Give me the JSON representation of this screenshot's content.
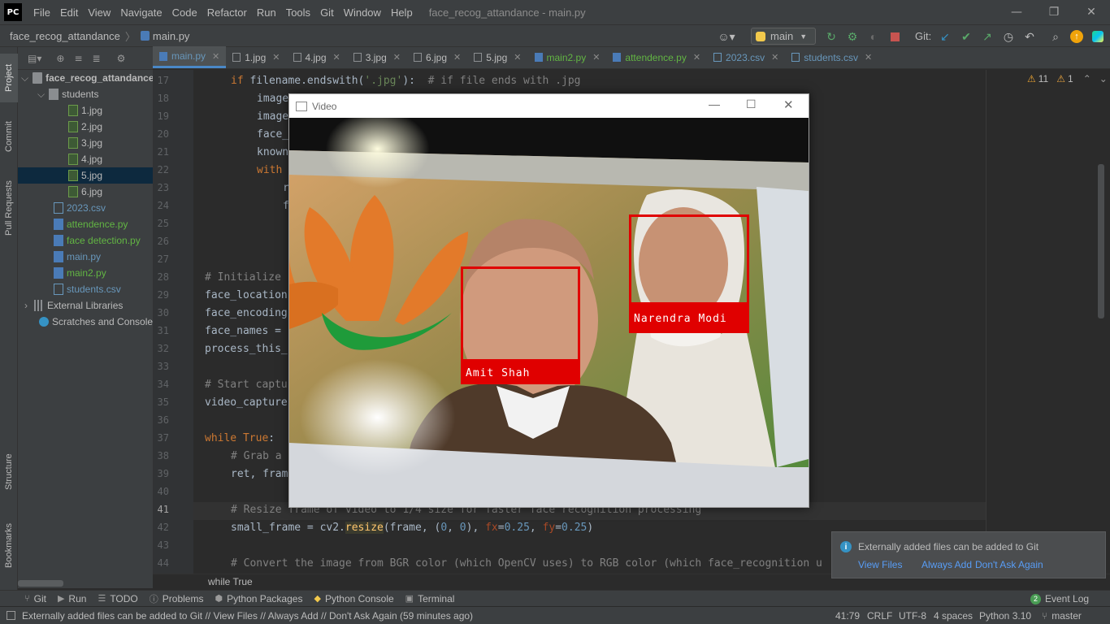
{
  "app": {
    "logo": "PC",
    "window_title": "face_recog_attandance - main.py",
    "menu": [
      "File",
      "Edit",
      "View",
      "Navigate",
      "Code",
      "Refactor",
      "Run",
      "Tools",
      "Git",
      "Window",
      "Help"
    ]
  },
  "navbar": {
    "project": "face_recog_attandance",
    "file": "main.py",
    "run_config": "main",
    "git_label": "Git:"
  },
  "left_stripe": {
    "project": "Project",
    "commit": "Commit",
    "pull_requests": "Pull Requests",
    "structure": "Structure",
    "bookmarks": "Bookmarks"
  },
  "project_tree": {
    "root": "face_recog_attandance",
    "students_folder": "students",
    "students_files": [
      "1.jpg",
      "2.jpg",
      "3.jpg",
      "4.jpg",
      "5.jpg",
      "6.jpg"
    ],
    "root_files": [
      "2023.csv",
      "attendence.py",
      "face detection.py",
      "main.py",
      "main2.py",
      "students.csv"
    ],
    "external": "External Libraries",
    "scratches": "Scratches and Consoles"
  },
  "tabs": [
    "main.py",
    "1.jpg",
    "4.jpg",
    "3.jpg",
    "6.jpg",
    "5.jpg",
    "main2.py",
    "attendence.py",
    "2023.csv",
    "students.csv"
  ],
  "editor": {
    "line_numbers": [
      "17",
      "18",
      "19",
      "20",
      "21",
      "22",
      "23",
      "24",
      "25",
      "26",
      "27",
      "28",
      "29",
      "30",
      "31",
      "32",
      "33",
      "34",
      "35",
      "36",
      "37",
      "38",
      "39",
      "40",
      "41",
      "42",
      "43",
      "44"
    ],
    "warnings": "11",
    "weak_warnings": "1",
    "breadcrumb": "while True"
  },
  "code": {
    "l17_kw": "if",
    "l17_a": " filename.endswith(",
    "l17_str": "'.jpg'",
    "l17_b": "):  ",
    "l17_cm": "# if file ends with .jpg",
    "l18": "image",
    "l19": "image",
    "l20": "face_",
    "l21": "known",
    "l22": "with",
    "l23": "r",
    "l24": "f",
    "l28": "# Initialize",
    "l29": "face_location",
    "l30": "face_encoding",
    "l31": "face_names =",
    "l32": "process_this_",
    "l34": "# Start captu",
    "l35": "video_capture",
    "l37_kw": "while",
    "l37_b": " True",
    "l37_c": ":",
    "l38": "# Grab a",
    "l39": "ret, fram",
    "l41": "# Resize frame of video to 1/4 size for faster face recognition processing",
    "l42_a": "small_frame = cv2.",
    "l42_fn": "resize",
    "l42_b": "(frame, (",
    "l42_n1": "0",
    "l42_c": ", ",
    "l42_n2": "0",
    "l42_d": "), ",
    "l42_p1": "fx",
    "l42_e": "=",
    "l42_n3": "0.25",
    "l42_f": ", ",
    "l42_p2": "fy",
    "l42_g": "=",
    "l42_n4": "0.25",
    "l42_h": ")",
    "l44": "# Convert the image from BGR color (which OpenCV uses) to RGB color (which face_recognition u"
  },
  "video_window": {
    "title": "Video",
    "faces": [
      {
        "name": "Amit Shah"
      },
      {
        "name": "Narendra Modi"
      }
    ]
  },
  "notification": {
    "message": "Externally added files can be added to Git",
    "actions": [
      "View Files",
      "Always Add",
      "Don't Ask Again"
    ]
  },
  "tool_windows": [
    "Git",
    "Run",
    "TODO",
    "Problems",
    "Python Packages",
    "Python Console",
    "Terminal"
  ],
  "event_log": {
    "count": "2",
    "label": "Event Log"
  },
  "status": {
    "message": "Externally added files can be added to Git // View Files // Always Add // Don't Ask Again (59 minutes ago)",
    "position": "41:79",
    "line_sep": "CRLF",
    "encoding": "UTF-8",
    "indent": "4 spaces",
    "interpreter": "Python 3.10",
    "branch": "master"
  },
  "colors": {
    "accent": "#4a88c7",
    "face_box": "#e00000",
    "link": "#589df6",
    "background": "#2b2b2b"
  }
}
